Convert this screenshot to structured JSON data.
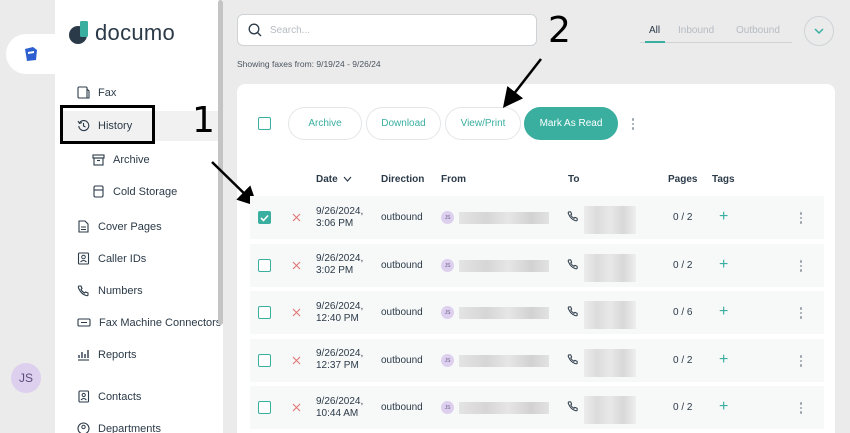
{
  "brand": {
    "name": "documo"
  },
  "user": {
    "initials": "JS"
  },
  "sidebar": {
    "items": [
      {
        "label": "Fax",
        "icon": "fax-icon"
      },
      {
        "label": "History",
        "icon": "history-icon"
      },
      {
        "label": "Archive",
        "icon": "archive-icon"
      },
      {
        "label": "Cold Storage",
        "icon": "cold-storage-icon"
      },
      {
        "label": "Cover Pages",
        "icon": "cover-pages-icon"
      },
      {
        "label": "Caller IDs",
        "icon": "caller-ids-icon"
      },
      {
        "label": "Numbers",
        "icon": "phone-icon"
      },
      {
        "label": "Fax Machine Connectors",
        "icon": "fax-connector-icon"
      },
      {
        "label": "Reports",
        "icon": "reports-icon"
      },
      {
        "label": "Contacts",
        "icon": "contacts-icon"
      },
      {
        "label": "Departments",
        "icon": "departments-icon"
      }
    ]
  },
  "search": {
    "placeholder": "Search..."
  },
  "showing_text": "Showing faxes from: 9/19/24 - 9/26/24",
  "filter_tabs": [
    "All",
    "Inbound",
    "Outbound"
  ],
  "actions": {
    "archive": "Archive",
    "download": "Download",
    "view_print": "View/Print",
    "mark_as_read": "Mark As Read"
  },
  "columns": {
    "date": "Date",
    "direction": "Direction",
    "from": "From",
    "to": "To",
    "pages": "Pages",
    "tags": "Tags"
  },
  "rows": [
    {
      "date_line1": "9/26/2024,",
      "date_line2": "3:06 PM",
      "direction": "outbound",
      "from_initials": "JS",
      "pages": "0 / 2",
      "checked": true
    },
    {
      "date_line1": "9/26/2024,",
      "date_line2": "3:02 PM",
      "direction": "outbound",
      "from_initials": "JS",
      "pages": "0 / 2",
      "checked": false
    },
    {
      "date_line1": "9/26/2024,",
      "date_line2": "12:40 PM",
      "direction": "outbound",
      "from_initials": "JS",
      "pages": "0 / 6",
      "checked": false
    },
    {
      "date_line1": "9/26/2024,",
      "date_line2": "12:37 PM",
      "direction": "outbound",
      "from_initials": "JS",
      "pages": "0 / 2",
      "checked": false
    },
    {
      "date_line1": "9/26/2024,",
      "date_line2": "10:44 AM",
      "direction": "outbound",
      "from_initials": "JS",
      "pages": "0 / 2",
      "checked": false
    }
  ],
  "annotations": {
    "step1": "1",
    "step2": "2"
  },
  "colors": {
    "accent": "#3aafa0",
    "text": "#2b3a48",
    "background": "#ebebeb"
  }
}
